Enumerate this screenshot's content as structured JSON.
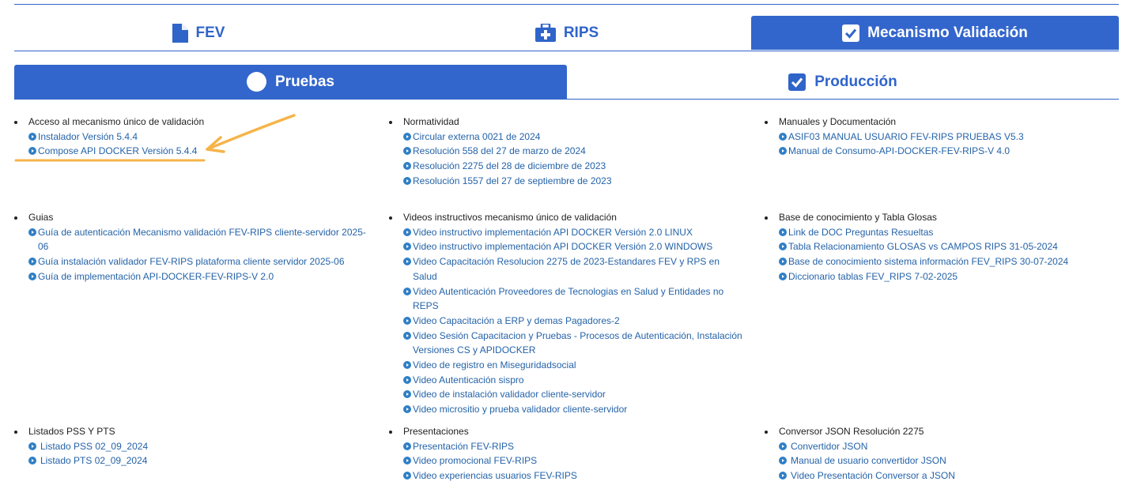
{
  "tabs": {
    "fev": "FEV",
    "rips": "RIPS",
    "mecanismo": "Mecanismo Validación",
    "icons": {
      "fev": "document-icon",
      "rips": "medical-briefcase-icon",
      "mecanismo": "checkbox-icon"
    }
  },
  "subtabs": {
    "pruebas": "Pruebas",
    "produccion": "Producción",
    "icons": {
      "pruebas": "circle-icon",
      "produccion": "checkbox-icon"
    }
  },
  "colors": {
    "primary": "#3366cc",
    "link": "#2563a8",
    "highlight": "#f5b44a"
  },
  "sections": [
    {
      "title": "Acceso al mecanismo único de validación",
      "links": [
        "Instalador Versión 5.4.4",
        "Compose API DOCKER Versión 5.4.4"
      ]
    },
    {
      "title": "Normatividad",
      "links": [
        "Circular externa 0021 de 2024",
        "Resolución 558 del 27 de marzo de 2024",
        "Resolución 2275 del 28 de diciembre de 2023",
        "Resolución 1557 del 27 de septiembre de 2023"
      ]
    },
    {
      "title": "Manuales y Documentación",
      "links": [
        " ASIF03 MANUAL USUARIO FEV-RIPS PRUEBAS V5.3",
        "Manual de Consumo-API-DOCKER-FEV-RIPS-V 4.0"
      ]
    },
    {
      "title": "Guias",
      "links": [
        "Guía de autenticación Mecanismo validación FEV-RIPS cliente-servidor 2025-06",
        "Guía instalación validador FEV-RIPS plataforma cliente servidor 2025-06",
        "Guía de implementación API-DOCKER-FEV-RIPS-V 2.0"
      ]
    },
    {
      "title": "Videos instructivos mecanismo único de validación",
      "links": [
        "Video instructivo implementación API DOCKER Versión 2.0 LINUX",
        "Video instructivo implementación API DOCKER Versión 2.0 WINDOWS",
        "Video Capacitación Resolucion 2275 de 2023-Estandares FEV y RPS en Salud",
        "Video Autenticación Proveedores de Tecnologias en Salud y Entidades no REPS",
        "Video Capacitación a ERP y demas Pagadores-2",
        "Video Sesión Capacitacion y Pruebas - Procesos de Autenticación, Instalación Versiones CS y APIDOCKER",
        "Video de registro en Miseguridadsocial",
        "Video Autenticación sispro",
        "Video de instalación validador cliente-servidor",
        "Video micrositio y prueba validador cliente-servidor"
      ]
    },
    {
      "title": "Base de conocimiento y Tabla Glosas",
      "links": [
        "Link de DOC Preguntas Resueltas",
        "Tabla Relacionamiento GLOSAS vs CAMPOS RIPS 31-05-2024",
        "Base de conocimiento sistema información FEV_RIPS 30-07-2024",
        "Diccionario tablas FEV_RIPS 7-02-2025"
      ]
    },
    {
      "title": "Listados PSS Y PTS",
      "links": [
        "Listado PSS 02_09_2024",
        "Listado PTS 02_09_2024"
      ]
    },
    {
      "title": "Presentaciones",
      "links": [
        "Presentación FEV-RIPS",
        "Video promocional FEV-RIPS",
        "Video experiencias usuarios FEV-RIPS"
      ]
    },
    {
      "title": "Conversor JSON Resolución 2275",
      "links": [
        "Convertidor JSON",
        "Manual de usuario convertidor JSON",
        "Video Presentación Conversor a JSON"
      ]
    }
  ]
}
